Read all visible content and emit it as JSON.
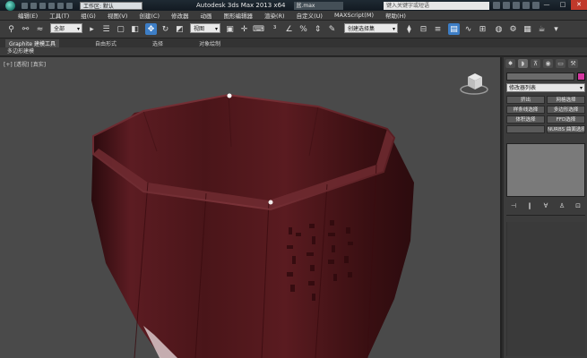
{
  "titlebar": {
    "workspace": "工作区: 默认",
    "title": "Autodesk 3ds Max  2013 x64",
    "filename": "盆.max",
    "search_placeholder": "键入关键字或短语",
    "win_min": "—",
    "win_max": "□",
    "win_close": "✕"
  },
  "menu": {
    "items": [
      "编辑(E)",
      "工具(T)",
      "组(G)",
      "视图(V)",
      "创建(C)",
      "修改器",
      "动画",
      "图形编辑器",
      "渲染(R)",
      "自定义(U)",
      "MAXScript(M)",
      "帮助(H)"
    ]
  },
  "toolbar": {
    "selection_filter": "全部",
    "ref_coord": "视图",
    "named_selection": "创建选择集"
  },
  "ribbon": {
    "tabs": [
      "Graphite 建模工具",
      "自由形式",
      "选择",
      "对象绘制"
    ],
    "sub_label": "多边形建模"
  },
  "viewport": {
    "label_plus": "[+]",
    "label_view": "[透视]",
    "label_shading": "[真实]"
  },
  "command_panel": {
    "modifier_list": "修改器列表",
    "mod_buttons": [
      "挤出",
      "网格选择",
      "样条线选择",
      "多边形选择",
      "体积选择",
      "FFD选择",
      "",
      "NURBS 曲面选择"
    ]
  },
  "colors": {
    "cup": "#5a1a1f",
    "object_color": "#d437a0",
    "active_button": "#3d7ec6"
  }
}
